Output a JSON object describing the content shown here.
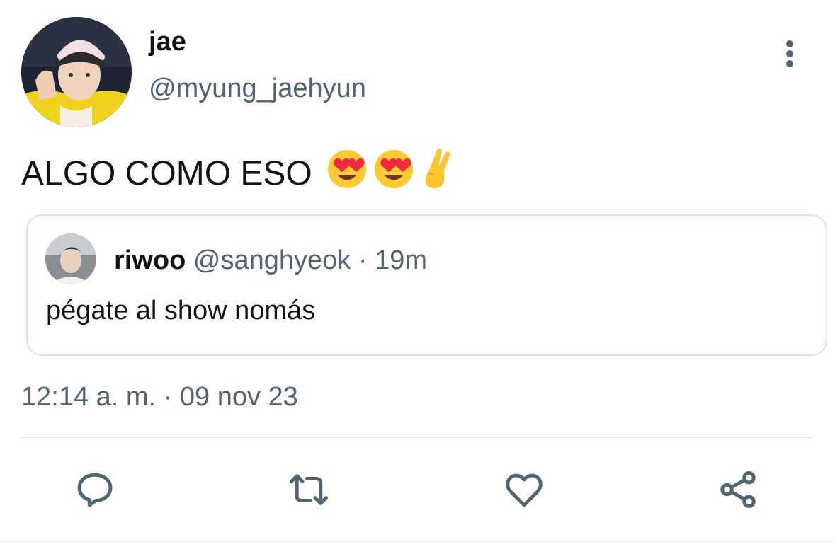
{
  "tweet": {
    "author": {
      "name": "jae",
      "handle": "@myung_jaehyun"
    },
    "text": "ALGO COMO ESO",
    "emojis": [
      "😍",
      "😍",
      "🤞"
    ],
    "quoted": {
      "name": "riwoo",
      "handle": "@sanghyeok",
      "separator": " · ",
      "time": "19m",
      "text": "pégate al show nomás"
    },
    "timestamp": "12:14 a. m. · 09 nov 23"
  },
  "actions": [
    "reply-icon",
    "retweet-icon",
    "like-icon",
    "share-icon"
  ],
  "colors": {
    "text": "#0f1419",
    "secondary": "#536471",
    "border": "#dbe3ea"
  }
}
